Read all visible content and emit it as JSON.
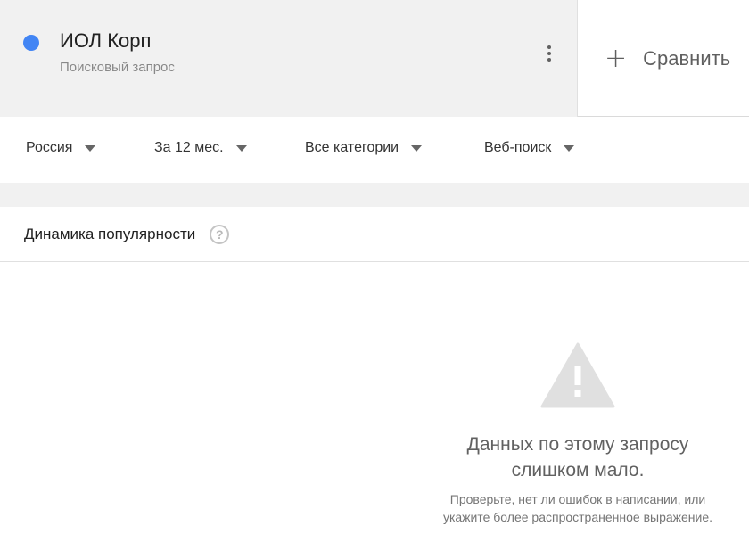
{
  "term": {
    "name": "ИОЛ Корп",
    "type": "Поисковый запрос",
    "color": "#4285f4"
  },
  "compare": {
    "icon": "plus-icon",
    "label": "Сравнить"
  },
  "filters": {
    "region": "Россия",
    "period": "За 12 мес.",
    "category": "Все категории",
    "search_type": "Веб-поиск"
  },
  "panel": {
    "title": "Динамика популярности",
    "help_icon": "help-circle-icon",
    "empty_title_line1": "Данных по этому запросу",
    "empty_title_line2": "слишком мало.",
    "empty_hint_line1": "Проверьте, нет ли ошибок в написании, или",
    "empty_hint_line2": "укажите более распространенное выражение."
  }
}
